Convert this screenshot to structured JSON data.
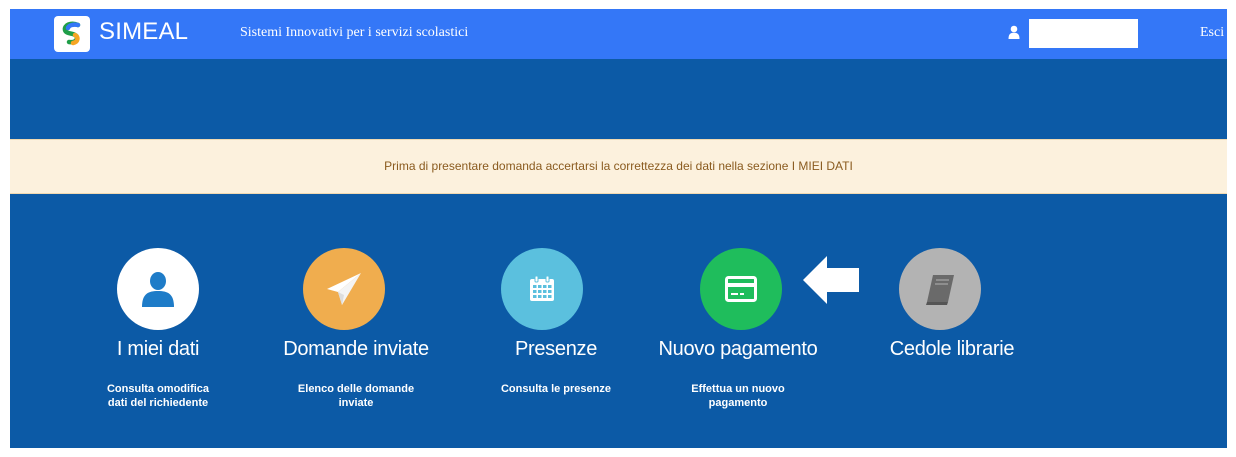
{
  "header": {
    "brand": "SIMEAL",
    "tagline": "Sistemi Innovativi per i servizi scolastici",
    "user_value": "",
    "logout_label": "Esci",
    "colors": {
      "bar": "#3477f7",
      "band": "#0c5aa6"
    }
  },
  "notice": {
    "text": "Prima di presentare domanda accertarsi la correttezza dei dati nella sezione I MIEI DATI"
  },
  "tiles": [
    {
      "title": "I miei dati",
      "desc": "Consulta omodifica dati del richiedente",
      "icon": "user-icon",
      "color": "#ffffff"
    },
    {
      "title": "Domande inviate",
      "desc": "Elenco delle domande inviate",
      "icon": "paper-plane-icon",
      "color": "#f0ad4e"
    },
    {
      "title": "Presenze",
      "desc": "Consulta le presenze",
      "icon": "calendar-icon",
      "color": "#5bc0de"
    },
    {
      "title": "Nuovo pagamento",
      "desc": "Effettua un nuovo pagamento",
      "icon": "credit-card-icon",
      "color": "#1fbd5c"
    },
    {
      "title": "Cedole librarie",
      "desc": "",
      "icon": "book-icon",
      "color": "#b3b3b3"
    }
  ]
}
